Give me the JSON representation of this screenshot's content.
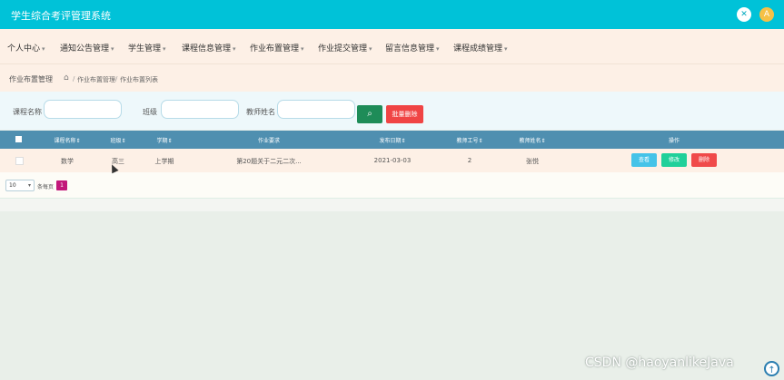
{
  "header": {
    "app_title": "学生综合考评管理系统",
    "tool_icon": "✕",
    "avatar_label": "A"
  },
  "nav": {
    "items": [
      {
        "label": "个人中心",
        "caret": "▾"
      },
      {
        "label": "通知公告管理",
        "caret": "▾"
      },
      {
        "label": "学生管理",
        "caret": "▾"
      },
      {
        "label": "课程信息管理",
        "caret": "▾"
      },
      {
        "label": "作业布置管理",
        "caret": "▾"
      },
      {
        "label": "作业提交管理",
        "caret": "▾"
      },
      {
        "label": "留言信息管理",
        "caret": "▾"
      },
      {
        "label": "课程成绩管理",
        "caret": "▾"
      }
    ]
  },
  "breadcrumb": {
    "section_title": "作业布置管理",
    "home_icon": "⌂",
    "sep": "/",
    "items": [
      "作业布置管理",
      "作业布置列表"
    ]
  },
  "search": {
    "course_label": "课程名称",
    "class_label": "班级",
    "teacher_label": "教师姓名",
    "course_value": "",
    "class_value": "",
    "teacher_value": "",
    "search_icon": "⌕",
    "batch_delete_label": "批量删除"
  },
  "table": {
    "columns": [
      "课程名称",
      "班级",
      "学期",
      "作业要求",
      "发布日期",
      "教师工号",
      "教师姓名",
      "操作"
    ],
    "sort_mark": "⇕",
    "rows": [
      {
        "course": "数学",
        "class": "高三",
        "term": "上学期",
        "requirement": "第20题关于二元二次...",
        "date": "2021-03-03",
        "teacher_no": "2",
        "teacher_name": "张悦",
        "actions": {
          "view": "查看",
          "edit": "修改",
          "delete": "删除"
        }
      }
    ]
  },
  "pager": {
    "page_size": "10",
    "chevron": "▾",
    "per_page_label": "条每页",
    "current_page": "1"
  },
  "watermark": "CSDN @haoyanlikeJava",
  "scroll_top_icon": "↑",
  "colors": {
    "topbar": "#00c2d8",
    "table_header": "#4f8fb0",
    "danger": "#f04444",
    "success": "#20d09a",
    "info": "#45c3e8",
    "search_btn": "#1e8c58",
    "page_active": "#c2187a"
  }
}
